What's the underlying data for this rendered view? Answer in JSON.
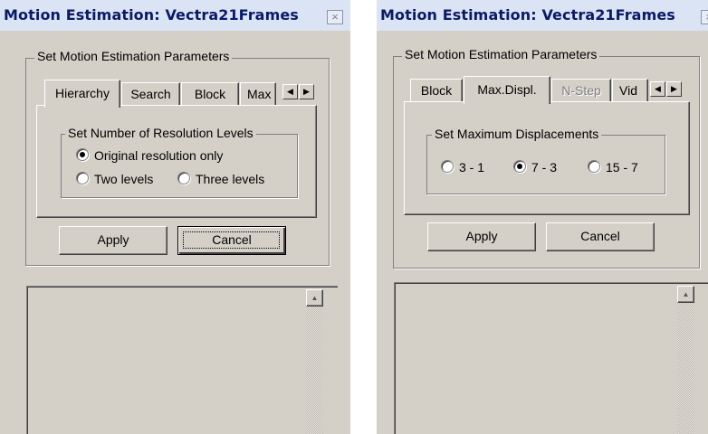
{
  "panels": [
    {
      "title": "Motion Estimation: Vectra21Frames",
      "close": "×",
      "group": "Set Motion Estimation Parameters",
      "tabs": [
        "Hierarchy",
        "Search",
        "Block",
        "Max"
      ],
      "active_tab": "Hierarchy",
      "inner_group": "Set Number of Resolution Levels",
      "options": [
        {
          "label": "Original resolution only",
          "selected": true
        },
        {
          "label": "Two levels",
          "selected": false
        },
        {
          "label": "Three levels",
          "selected": false
        }
      ],
      "apply": "Apply",
      "cancel": "Cancel",
      "default_button": "Cancel"
    },
    {
      "title": "Motion Estimation: Vectra21Frames",
      "close": "×",
      "group": "Set Motion Estimation Parameters",
      "tabs": [
        "Block",
        "Max.Displ.",
        "N-Step",
        "Vid"
      ],
      "active_tab": "Max.Displ.",
      "disabled_tab": "N-Step",
      "inner_group": "Set Maximum Displacements",
      "options": [
        {
          "label": "3 - 1",
          "selected": false
        },
        {
          "label": "7 - 3",
          "selected": true
        },
        {
          "label": "15 - 7",
          "selected": false
        }
      ],
      "apply": "Apply",
      "cancel": "Cancel",
      "default_button": "Apply"
    }
  ],
  "icons": {
    "tab_scroll_left": "◀",
    "tab_scroll_right": "▶",
    "scroll_up": "▲"
  },
  "colors": {
    "dialog_face": "#d4d0c8",
    "titlebar": "#dbe4f4",
    "title_text": "#0a1a66",
    "disabled_text": "#808080"
  }
}
